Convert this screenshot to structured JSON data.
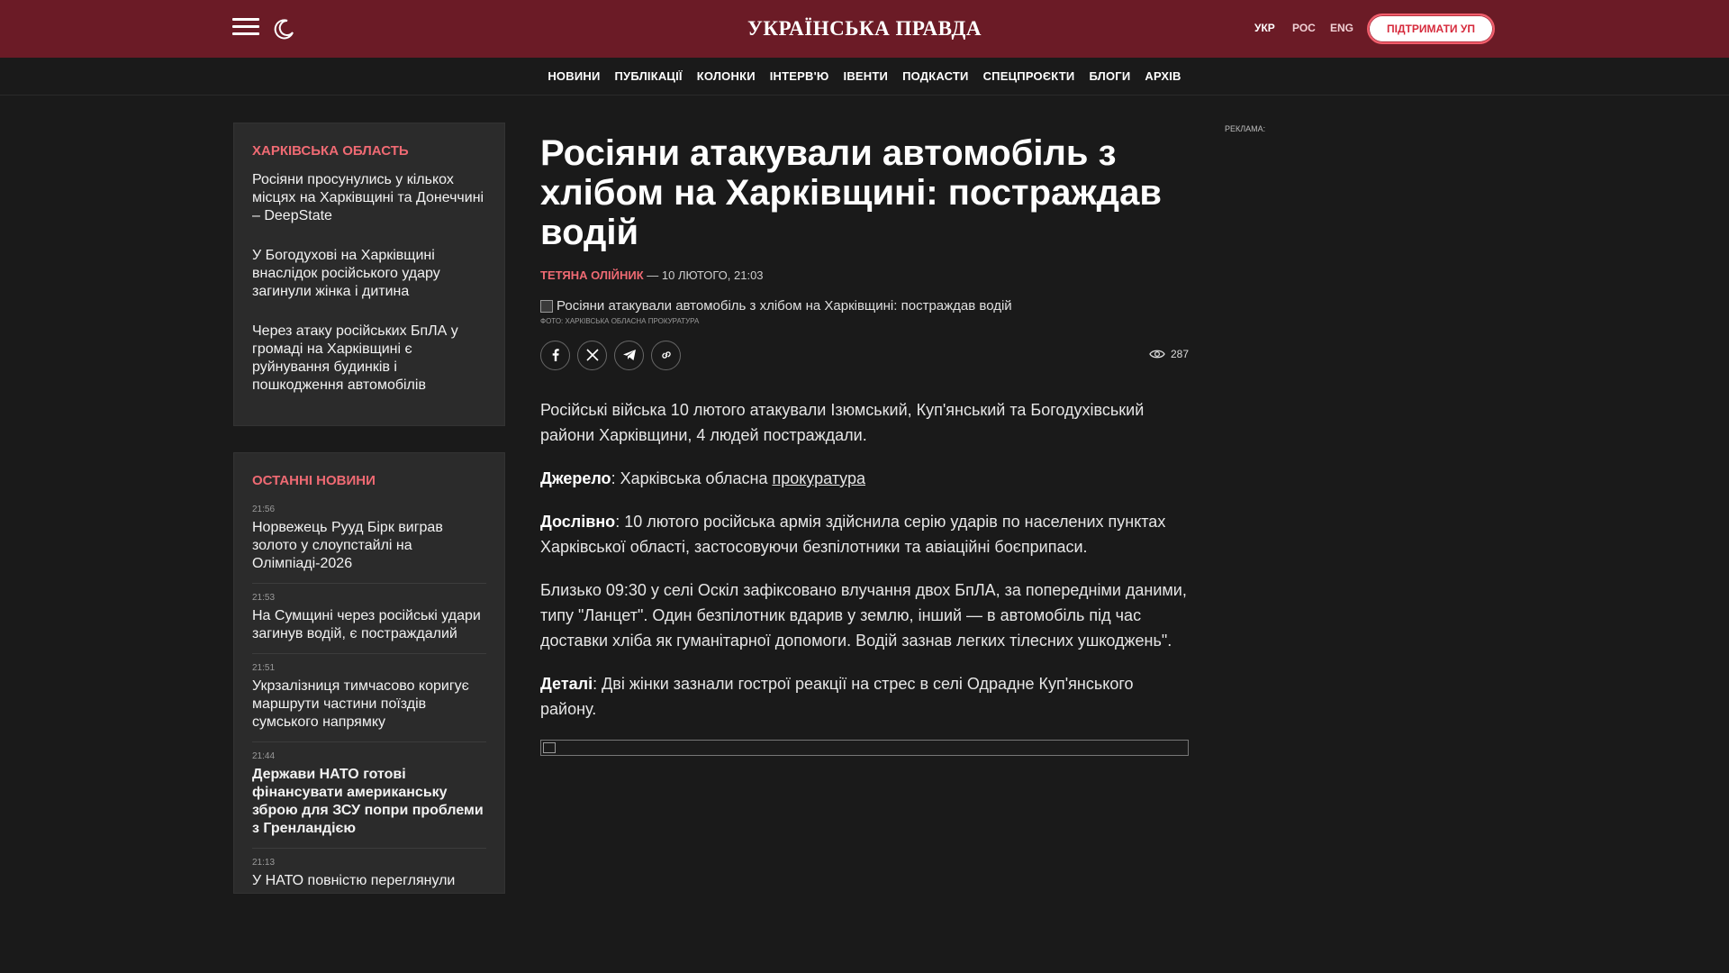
{
  "header": {
    "logo": "УКРАЇНСЬКА ПРАВДА",
    "languages": [
      {
        "label": "УКР",
        "active": true
      },
      {
        "label": "РОС",
        "active": false
      },
      {
        "label": "ENG",
        "active": false
      }
    ],
    "support_label": "ПІДТРИМАТИ УП",
    "icons": {
      "menu": "hamburger-menu-icon",
      "theme": "moon-icon"
    }
  },
  "nav": {
    "items": [
      "НОВИНИ",
      "ПУБЛІКАЦІЇ",
      "КОЛОНКИ",
      "ІНТЕРВ'Ю",
      "ІВЕНТИ",
      "ПОДКАСТИ",
      "СПЕЦПРОЄКТИ",
      "БЛОГИ",
      "АРХІВ"
    ]
  },
  "related": {
    "title": "ХАРКІВСЬКА ОБЛАСТЬ",
    "items": [
      "Росіяни просунулись у кількох місцях на Харківщині та Донеччині – DeepState",
      "У Богодухові на Харківщині внаслідок російського удару загинули жінка і дитина",
      "Через атаку російських БпЛА у громаді на Харківщині є руйнування будинків і пошкодження автомобілів"
    ]
  },
  "latest": {
    "title": "ОСТАННІ НОВИНИ",
    "items": [
      {
        "time": "21:56",
        "title": "Норвежець Рууд Бірк виграв золото у слоупстайлі на Олімпіаді-2026",
        "bold": false
      },
      {
        "time": "21:53",
        "title": "На Сумщині через російські удари загинув водій, є постраждалий",
        "bold": false
      },
      {
        "time": "21:51",
        "title": "Укрзалізниця тимчасово коригує маршрути частини поїздів сумського напрямку",
        "bold": false
      },
      {
        "time": "21:44",
        "title": "Держави НАТО готові фінансувати американську зброю для ЗСУ попри проблеми з Гренландією",
        "bold": true
      },
      {
        "time": "21:13",
        "title": "У НАТО повністю переглянули",
        "bold": false
      }
    ]
  },
  "article": {
    "headline": "Росіяни атакували автомобіль з хлібом на Харківщині: постраждав водій",
    "author": "ТЕТЯНА ОЛІЙНИК",
    "date": " — 10 ЛЮТОГО, 21:03",
    "photo_alt": "Росіяни атакували автомобіль з хлібом на Харківщині: постраждав водій",
    "photo_credit": "Фото: Харківська обласна прокуратура",
    "views": "287",
    "lead": "Російські війська 10 лютого атакували Ізюмський, Куп'янський та Богодухівський райони Харківщини, 4 людей постраждали.",
    "source_label": "Джерело",
    "source_text": ": Харківська обласна ",
    "source_link": "прокуратура",
    "quote_label": "Дослівно",
    "quote_text": ": 10 лютого російська армія здійснила серію ударів по населених пунктах Харківської області, застосовуючи безпілотники та авіаційні боєприпаси.",
    "para2": "Близько 09:30 у селі Оскіл зафіксовано влучання двох БпЛА, за попередніми даними, типу \"Ланцет\". Один безпілотник вдарив у землю, інший — в автомобіль під час доставки хліба як гуманітарної допомоги. Водій зазнав легких тілесних ушкоджень\".",
    "details_label": "Деталі",
    "details_text": ": Дві жінки зазнали гострої реакції на стрес в селі Одрадне Куп'янського району."
  },
  "ad_label": "РЕКЛАМА:",
  "colors": {
    "header_bg": "#6b1b26",
    "accent": "#ef6a73",
    "background": "#1a1a1a"
  }
}
